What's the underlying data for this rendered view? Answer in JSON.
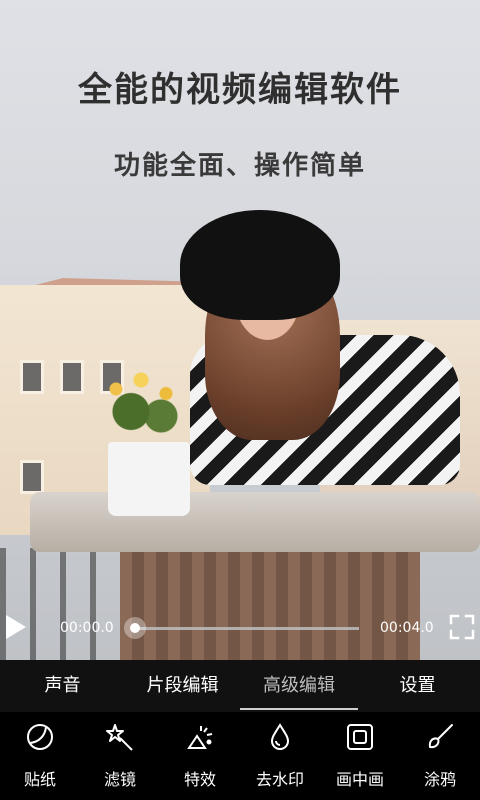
{
  "headline": {
    "title": "全能的视频编辑软件",
    "subtitle": "功能全面、操作简单"
  },
  "player": {
    "current_time": "00:00.0",
    "total_time": "00:04.0",
    "progress": 0
  },
  "tabs": [
    {
      "label": "声音",
      "active": false
    },
    {
      "label": "片段编辑",
      "active": false
    },
    {
      "label": "高级编辑",
      "active": true
    },
    {
      "label": "设置",
      "active": false
    }
  ],
  "tools": [
    {
      "label": "贴纸",
      "icon": "sticker-icon"
    },
    {
      "label": "滤镜",
      "icon": "magic-wand-icon"
    },
    {
      "label": "特效",
      "icon": "effects-icon"
    },
    {
      "label": "去水印",
      "icon": "water-drop-icon"
    },
    {
      "label": "画中画",
      "icon": "picture-in-picture-icon"
    },
    {
      "label": "涂鸦",
      "icon": "brush-icon"
    }
  ],
  "colors": {
    "tab_bar_bg": "#111111",
    "tools_bg": "#000000",
    "active_tab_text": "#bdbdbd"
  }
}
